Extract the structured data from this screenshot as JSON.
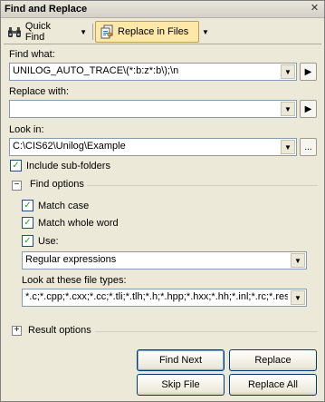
{
  "window": {
    "title": "Find and Replace"
  },
  "toolbar": {
    "quick_find": "Quick Find",
    "replace_in_files": "Replace in Files"
  },
  "find_what": {
    "label": "Find what:",
    "value": "UNILOG_AUTO_TRACE\\(*:b:z*:b\\);\\n"
  },
  "replace_with": {
    "label": "Replace with:",
    "value": ""
  },
  "look_in": {
    "label": "Look in:",
    "value": "C:\\CIS62\\Unilog\\Example",
    "browse_label": "..."
  },
  "include_subfolders": {
    "label": "Include sub-folders",
    "checked": true
  },
  "find_options": {
    "title": "Find options",
    "match_case": {
      "label": "Match case",
      "checked": true
    },
    "match_whole_word": {
      "label": "Match whole word",
      "checked": true
    },
    "use": {
      "label": "Use:",
      "checked": true
    },
    "use_value": "Regular expressions",
    "file_types_label": "Look at these file types:",
    "file_types_value": "*.c;*.cpp;*.cxx;*.cc;*.tli;*.tlh;*.h;*.hpp;*.hxx;*.hh;*.inl;*.rc;*.resx"
  },
  "result_options": {
    "title": "Result options"
  },
  "buttons": {
    "find_next": "Find Next",
    "replace": "Replace",
    "skip_file": "Skip File",
    "replace_all": "Replace All"
  },
  "icons": {
    "close": "close-icon",
    "quick_find": "binoculars-icon",
    "replace_in_files": "replace-files-icon",
    "dropdown": "chevron-down-icon",
    "expand": "arrow-right-icon"
  }
}
